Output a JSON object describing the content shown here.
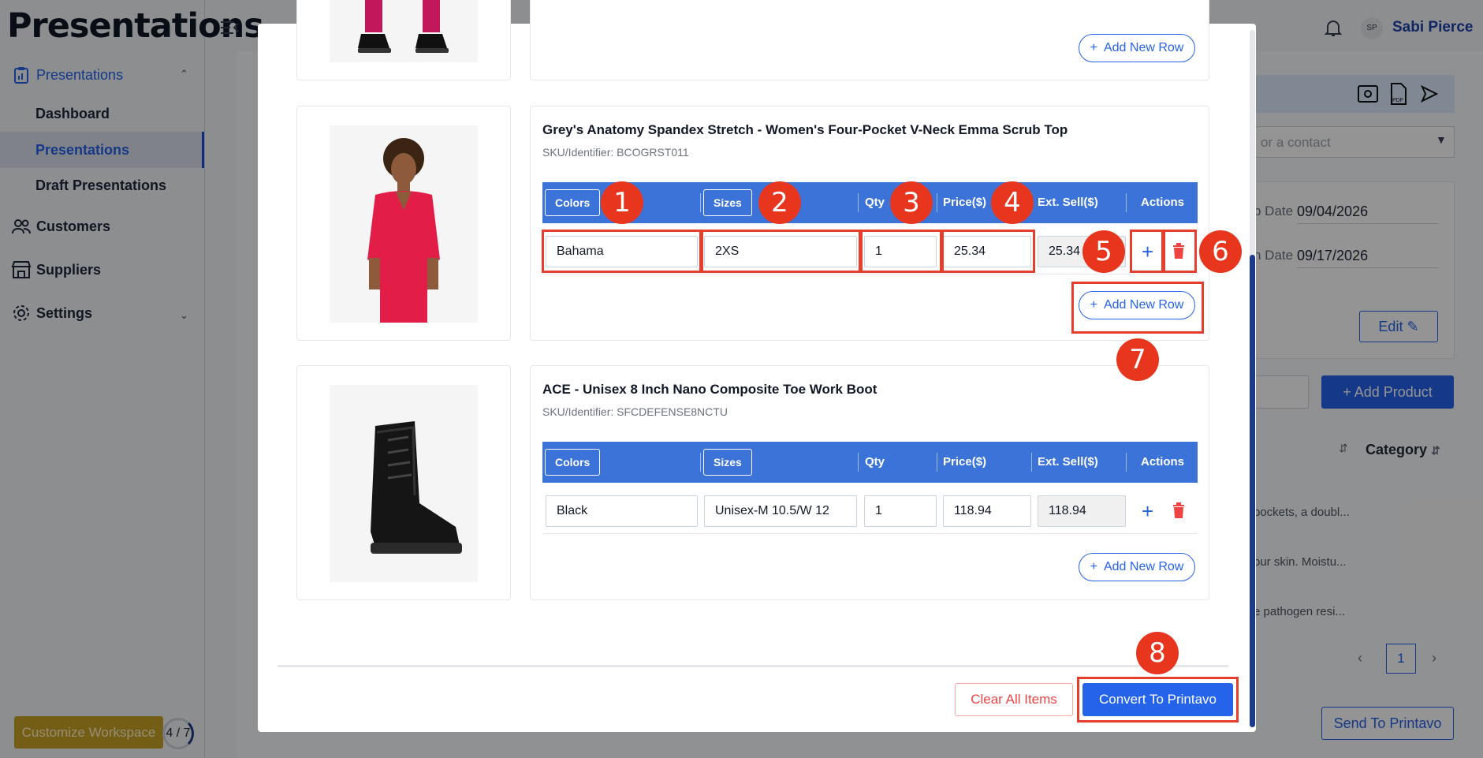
{
  "app": {
    "title": "Presentations",
    "user_name": "Sabi Pierce",
    "user_initials": "SP"
  },
  "sidebar": {
    "sections": [
      {
        "label": "Presentations",
        "icon": "clipboard-icon"
      },
      {
        "label": "Customers",
        "icon": "users-icon"
      },
      {
        "label": "Suppliers",
        "icon": "store-icon"
      },
      {
        "label": "Settings",
        "icon": "gear-icon"
      }
    ],
    "sub_items": [
      "Dashboard",
      "Presentations",
      "Draft Presentations"
    ],
    "customize_label": "Customize Workspace",
    "progress_text": "4 / 7",
    "progress_fraction": 0.57
  },
  "background": {
    "contact_placeholder": "or a contact",
    "date_label_1": "p Date",
    "date_value_1": "09/04/2026",
    "date_label_2": "n Date",
    "date_value_2": "09/17/2026",
    "edit_label": "Edit",
    "add_product_label": "Add Product",
    "category_label": "Category",
    "row_snippets": [
      "pockets, a doubl...",
      "our skin. Moistu...",
      "e pathogen resi..."
    ],
    "page_number": "1",
    "send_label": "Send To Printavo"
  },
  "modal": {
    "table_headers": {
      "colors": "Colors",
      "sizes": "Sizes",
      "qty": "Qty",
      "price": "Price($)",
      "ext_sell": "Ext. Sell($)",
      "actions": "Actions"
    },
    "add_row_label": "Add New Row",
    "products": [
      {
        "title": "Grey's Anatomy Spandex Stretch - Women's Four-Pocket V-Neck Emma Scrub Top",
        "sku": "SKU/Identifier: BCOGRST011",
        "row": {
          "color": "Bahama",
          "size": "2XS",
          "qty": "1",
          "price": "25.34",
          "ext_sell": "25.34"
        }
      },
      {
        "title": "ACE - Unisex 8 Inch Nano Composite Toe Work Boot",
        "sku": "SKU/Identifier: SFCDEFENSE8NCTU",
        "row": {
          "color": "Black",
          "size": "Unisex-M 10.5/W 12",
          "qty": "1",
          "price": "118.94",
          "ext_sell": "118.94"
        }
      }
    ],
    "clear_label": "Clear All Items",
    "convert_label": "Convert To Printavo"
  },
  "annotations": [
    "1",
    "2",
    "3",
    "4",
    "5",
    "6",
    "7",
    "8"
  ],
  "colors": {
    "accent": "#2563eb",
    "table_header": "#3b73d9",
    "annotation": "#e8361e",
    "danger": "#ef4444"
  }
}
